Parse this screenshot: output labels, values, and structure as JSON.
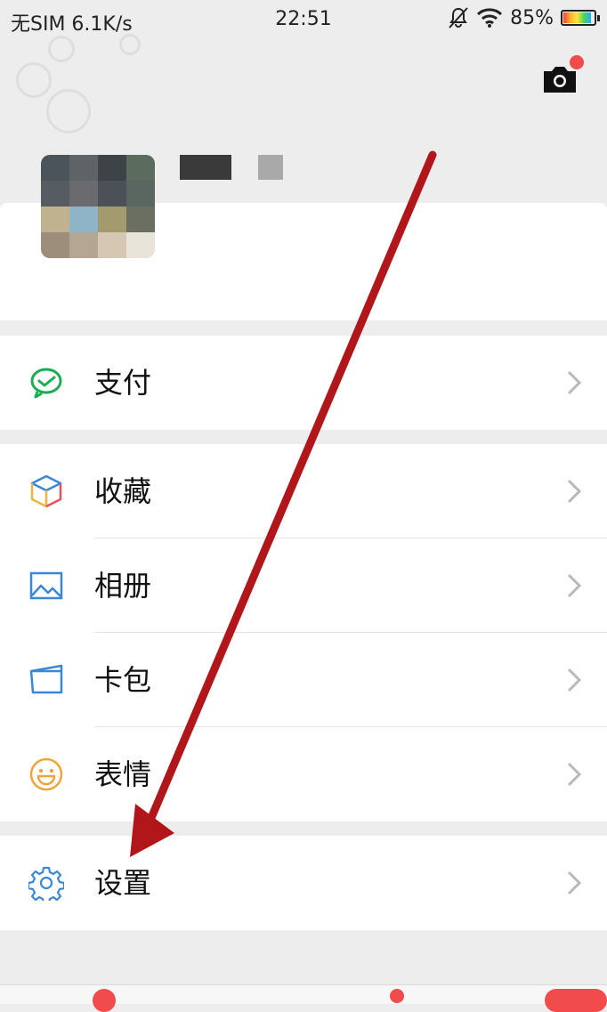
{
  "status_bar": {
    "carrier": "无SIM 6.1K/s",
    "time": "22:51",
    "battery": "85%",
    "icons": [
      "mute-bell-icon",
      "wifi-icon",
      "battery-icon"
    ]
  },
  "header": {
    "camera_icon": "camera-icon",
    "camera_badge": true
  },
  "menu": {
    "pay": {
      "label": "支付",
      "icon": "wechat-pay-icon"
    },
    "favorites": {
      "label": "收藏",
      "icon": "cube-icon"
    },
    "album": {
      "label": "相册",
      "icon": "picture-icon"
    },
    "cards": {
      "label": "卡包",
      "icon": "card-icon"
    },
    "stickers": {
      "label": "表情",
      "icon": "smile-icon"
    },
    "settings": {
      "label": "设置",
      "icon": "gear-icon"
    }
  },
  "colors": {
    "background": "#ededed",
    "annotation_arrow": "#b0161a",
    "badge": "#f24b4b",
    "pay_green": "#1aad52",
    "icon_blue": "#3a87d6",
    "smile_orange": "#f0a33b"
  }
}
